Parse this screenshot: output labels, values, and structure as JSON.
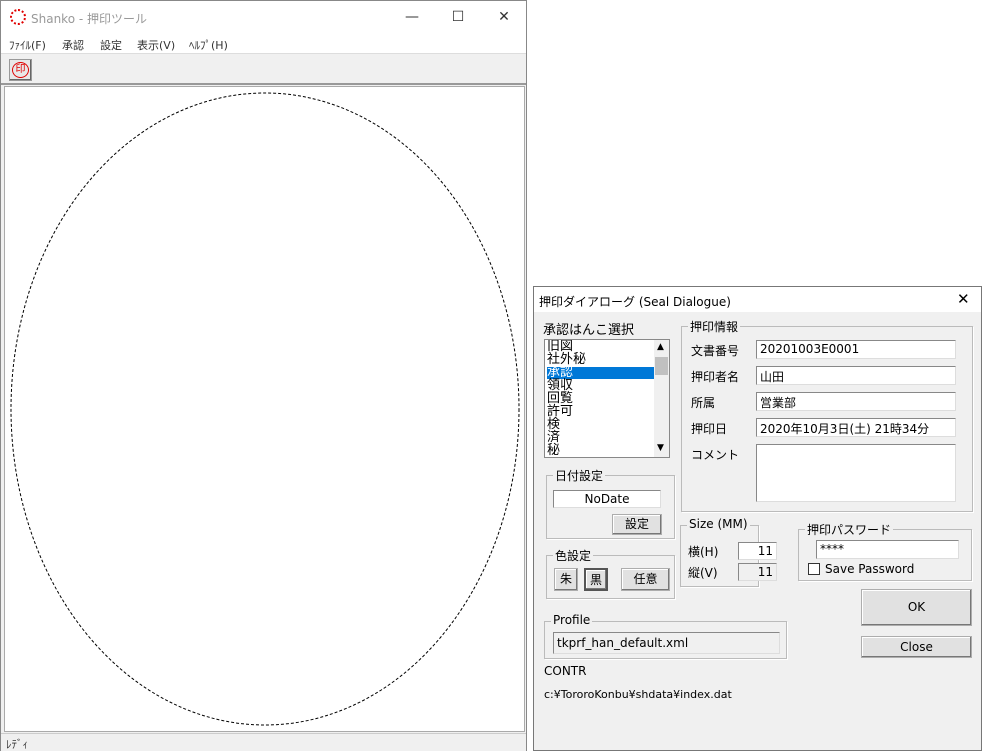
{
  "main": {
    "title": "Shanko - 押印ツール",
    "menu": [
      "ﾌｧｲﾙ(F)",
      "承認",
      "設定",
      "表示(V)",
      "ﾍﾙﾌﾟ(H)"
    ],
    "toolbar_seal": "印",
    "status": "ﾚﾃﾞｨ",
    "window_controls": {
      "minimize": "—",
      "maximize": "☐",
      "close": "✕"
    }
  },
  "dialog": {
    "title": "押印ダイアローグ (Seal Dialogue)",
    "close": "✕",
    "seal_select_label": "承認はんこ選択",
    "seals": [
      "旧図",
      "社外秘",
      "承認",
      "領収",
      "回覧",
      "許可",
      "検",
      "済",
      "秘"
    ],
    "selected_seal": "承認",
    "date_group": {
      "label": "日付設定",
      "value": "NoDate",
      "button": "設定"
    },
    "color_group": {
      "label": "色設定",
      "buttons": [
        "朱",
        "黒",
        "任意"
      ],
      "seal_color": "#e00000"
    },
    "info_group": {
      "label": "押印情報",
      "rows": [
        {
          "label": "文書番号",
          "value": "20201003E0001"
        },
        {
          "label": "押印者名",
          "value": "山田"
        },
        {
          "label": "所属",
          "value": "営業部"
        },
        {
          "label": "押印日",
          "value": "2020年10月3日(土) 21時34分"
        }
      ],
      "comment_label": "コメント",
      "comment": ""
    },
    "size_group": {
      "label": "Size (MM)",
      "h_label": "横(H)",
      "h": "11",
      "v_label": "縦(V)",
      "v": "11"
    },
    "password_group": {
      "label": "押印パスワード",
      "value": "****",
      "save_label": "Save Password",
      "save_checked": false
    },
    "ok": "OK",
    "close_btn": "Close",
    "profile_group": {
      "label": "Profile",
      "value": "tkprf_han_default.xml"
    },
    "contr": "CONTR",
    "path": "c:¥TororoKonbu¥shdata¥index.dat"
  }
}
